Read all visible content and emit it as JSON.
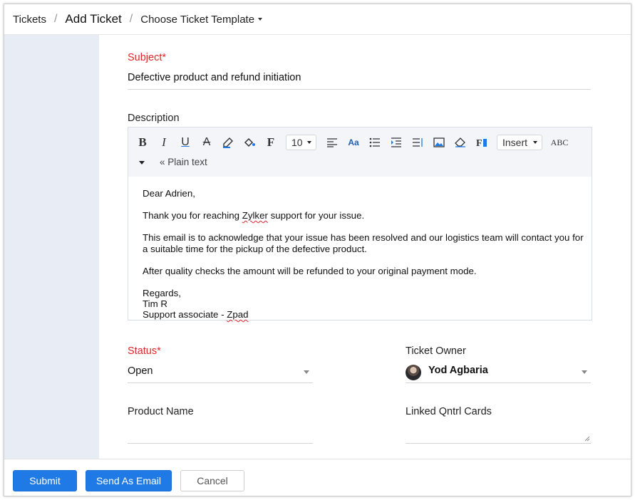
{
  "breadcrumb": {
    "tickets": "Tickets",
    "separator": "/",
    "add_ticket": "Add Ticket",
    "template": "Choose Ticket Template"
  },
  "form": {
    "subject": {
      "label": "Subject",
      "required_mark": "*",
      "value": "Defective product and refund initiation"
    },
    "description": {
      "label": "Description",
      "toolbar": {
        "bold": "B",
        "italic": "I",
        "underline": "U",
        "strike": "A",
        "font": "F",
        "font_size": "10",
        "insert": "Insert",
        "spellcheck": "ABC",
        "plain_text": "« Plain text"
      },
      "body": {
        "greeting": "Dear Adrien,",
        "line1_a": "Thank you for reaching ",
        "line1_b": "Zylker",
        "line1_c": " support for your issue.",
        "line2_a": "This email is to acknowledge that your issue has been resolved and our logistics team will contact you for",
        "line2_b": "a suitable time for the pickup of the defective product.",
        "line3": "After quality checks the amount will be refunded to your original payment mode.",
        "regards": "Regards,",
        "name": "Tim R",
        "sig_a": "Support associate - ",
        "sig_b": "Zpad"
      }
    },
    "status": {
      "label": "Status",
      "required_mark": "*",
      "value": "Open"
    },
    "ticket_owner": {
      "label": "Ticket Owner",
      "value": "Yod Agbaria"
    },
    "product_name": {
      "label": "Product Name",
      "value": ""
    },
    "linked_cards": {
      "label": "Linked Qntrl Cards",
      "value": ""
    }
  },
  "footer": {
    "submit": "Submit",
    "send_email": "Send As Email",
    "cancel": "Cancel"
  },
  "colors": {
    "primary": "#1f7ae5",
    "required": "#e0252a",
    "sidebar": "#e8ecf4"
  }
}
